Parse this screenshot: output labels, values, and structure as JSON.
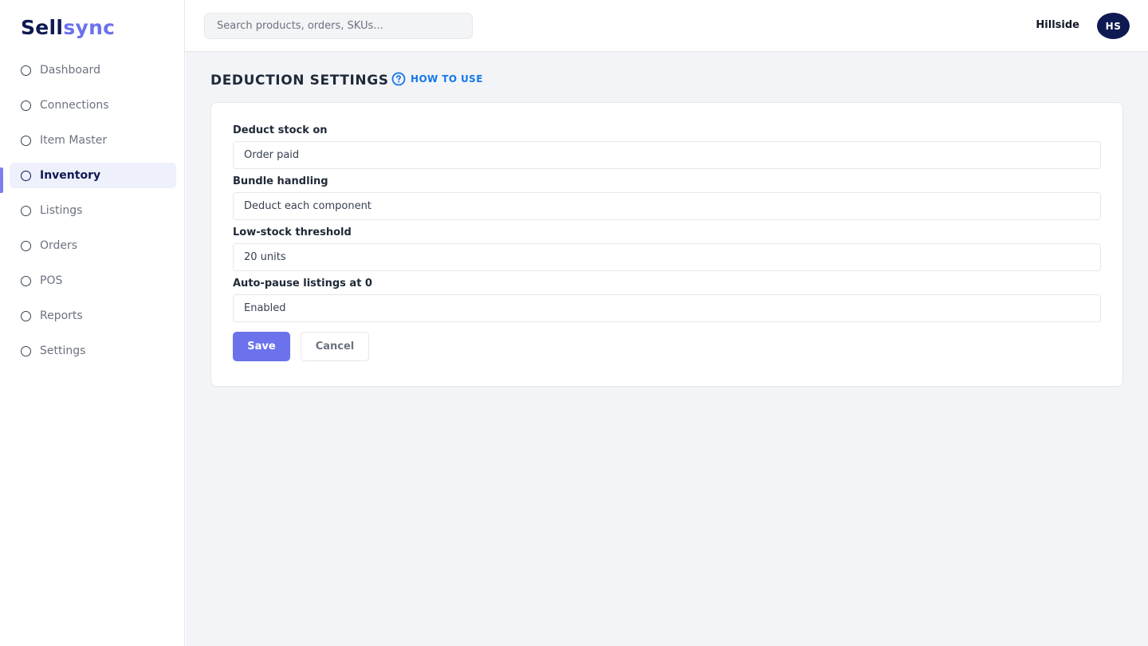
{
  "brand": {
    "part1": "Sell",
    "part2": "sync",
    "accent_color": "#6b72ec",
    "primary_color": "#0f1a52"
  },
  "sidebar": {
    "items": [
      {
        "label": "Dashboard",
        "active": false
      },
      {
        "label": "Connections",
        "active": false
      },
      {
        "label": "Item Master",
        "active": false
      },
      {
        "label": "Inventory",
        "active": true
      },
      {
        "label": "Listings",
        "active": false
      },
      {
        "label": "Orders",
        "active": false
      },
      {
        "label": "POS",
        "active": false
      },
      {
        "label": "Reports",
        "active": false
      },
      {
        "label": "Settings",
        "active": false
      }
    ]
  },
  "header": {
    "search_placeholder": "Search products, orders, SKUs...",
    "store_name": "Hillside",
    "avatar_initials": "HS"
  },
  "page": {
    "title": "DEDUCTION SETTINGS",
    "howto_label": "HOW TO USE",
    "howto_icon": "help-circle-icon",
    "howto_color": "#1677e8"
  },
  "form": {
    "fields": [
      {
        "label": "Deduct stock on",
        "value": "Order paid"
      },
      {
        "label": "Bundle handling",
        "value": "Deduct each component"
      },
      {
        "label": "Low-stock threshold",
        "value": "20 units"
      },
      {
        "label": "Auto-pause listings at 0",
        "value": "Enabled"
      }
    ],
    "save_label": "Save",
    "cancel_label": "Cancel"
  }
}
